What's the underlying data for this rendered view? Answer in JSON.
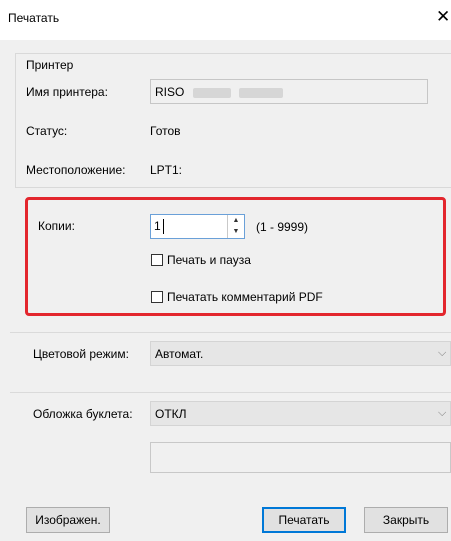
{
  "window": {
    "title": "Печатать",
    "close_glyph": "✕"
  },
  "printer_group": {
    "legend": "Принтер",
    "name_label": "Имя принтера:",
    "name_value": "RISO",
    "status_label": "Статус:",
    "status_value": "Готов",
    "location_label": "Местоположение:",
    "location_value": "LPT1:"
  },
  "copies": {
    "label": "Копии:",
    "value": "1",
    "range": "(1 - 9999)",
    "print_and_pause": {
      "label": "Печать и пауза",
      "checked": false
    },
    "print_pdf_comments": {
      "label": "Печатать комментарий PDF",
      "checked": false
    }
  },
  "color_mode": {
    "label": "Цветовой режим:",
    "value": "Автомат."
  },
  "booklet_cover": {
    "label": "Обложка буклета:",
    "value": "ОТКЛ"
  },
  "buttons": {
    "image": "Изображен.",
    "print": "Печатать",
    "close": "Закрыть"
  },
  "icons": {
    "close": "close-icon",
    "spin_up": "spin-up-icon",
    "spin_down": "spin-down-icon",
    "dropdown": "chevron-down-icon"
  },
  "colors": {
    "highlight": "#e3262d",
    "dialog_bg": "#f0f0f0",
    "focus_border": "#0078d7"
  }
}
